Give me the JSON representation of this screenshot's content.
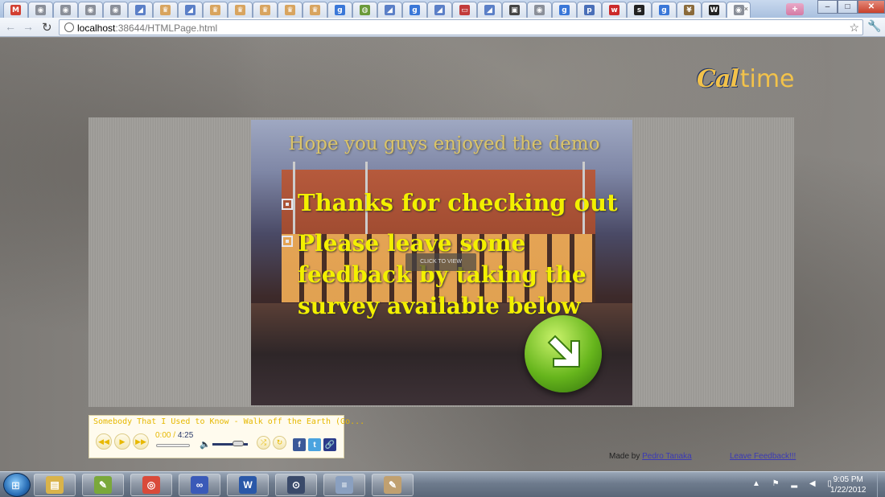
{
  "browser": {
    "tabs": [
      {
        "icon": "gmail-icon",
        "glyph": "M",
        "color": "#d23f31"
      },
      {
        "icon": "page-icon",
        "glyph": "◉",
        "color": "#8a8f99"
      },
      {
        "icon": "page-icon",
        "glyph": "◉",
        "color": "#8a8f99"
      },
      {
        "icon": "page-icon",
        "glyph": "◉",
        "color": "#8a8f99"
      },
      {
        "icon": "page-icon",
        "glyph": "◉",
        "color": "#8a8f99"
      },
      {
        "icon": "docs-icon",
        "glyph": "◢",
        "color": "#5b7fc7"
      },
      {
        "icon": "crown-icon",
        "glyph": "♛",
        "color": "#d8a45f"
      },
      {
        "icon": "docs-icon",
        "glyph": "◢",
        "color": "#5b7fc7"
      },
      {
        "icon": "crown-icon",
        "glyph": "♛",
        "color": "#d8a45f"
      },
      {
        "icon": "crown-icon",
        "glyph": "♛",
        "color": "#d8a45f"
      },
      {
        "icon": "crown-icon",
        "glyph": "♛",
        "color": "#d8a45f"
      },
      {
        "icon": "crown-icon",
        "glyph": "♛",
        "color": "#d8a45f"
      },
      {
        "icon": "crown-icon",
        "glyph": "♛",
        "color": "#d8a45f"
      },
      {
        "icon": "google-icon",
        "glyph": "g",
        "color": "#3a77d8"
      },
      {
        "icon": "globe-icon",
        "glyph": "◍",
        "color": "#6a9a3a"
      },
      {
        "icon": "docs-icon",
        "glyph": "◢",
        "color": "#5b7fc7"
      },
      {
        "icon": "google-icon",
        "glyph": "g",
        "color": "#3a77d8"
      },
      {
        "icon": "docs-icon",
        "glyph": "◢",
        "color": "#5b7fc7"
      },
      {
        "icon": "card-icon",
        "glyph": "▭",
        "color": "#c23b3b"
      },
      {
        "icon": "docs-icon",
        "glyph": "◢",
        "color": "#5b7fc7"
      },
      {
        "icon": "scholar-icon",
        "glyph": "▣",
        "color": "#444"
      },
      {
        "icon": "page-icon",
        "glyph": "◉",
        "color": "#8a8f99"
      },
      {
        "icon": "google-icon",
        "glyph": "g",
        "color": "#3a77d8"
      },
      {
        "icon": "p-icon",
        "glyph": "p",
        "color": "#4a6fb8"
      },
      {
        "icon": "w-red-icon",
        "glyph": "w",
        "color": "#cc2a2a"
      },
      {
        "icon": "sf-icon",
        "glyph": "s",
        "color": "#222"
      },
      {
        "icon": "google-icon",
        "glyph": "g",
        "color": "#3a77d8"
      },
      {
        "icon": "book-icon",
        "glyph": "¥",
        "color": "#8a6a3a"
      },
      {
        "icon": "wikipedia-icon",
        "glyph": "W",
        "color": "#222"
      },
      {
        "icon": "page-icon",
        "glyph": "◉",
        "color": "#8a8f99",
        "close": "×"
      }
    ],
    "new_tab": "+",
    "window_controls": {
      "minimize": "–",
      "maximize": "□",
      "close": "✕"
    },
    "back": "←",
    "forward": "→",
    "reload": "↻",
    "url_host": "localhost",
    "url_rest": ":38644/HTMLPage.html",
    "bookmark_star": "☆",
    "wrench": "🔧"
  },
  "page": {
    "logo_cal": "Cal",
    "logo_time": "time",
    "slide": {
      "title": "Hope you guys enjoyed the demo",
      "bullets": [
        "Thanks for checking out",
        "Please leave some feedback by taking the survey available below"
      ],
      "overlay": "CLICK TO VIEW"
    },
    "player": {
      "track": "Somebody That I Used to Know - Walk off the Earth (Go...",
      "time_current": "0:00",
      "time_sep": " / ",
      "time_total": "4:25",
      "progress": 0,
      "volume": 0.8,
      "rewind": "◀◀",
      "play": "▶",
      "forward": "▶▶",
      "shuffle": "⤮",
      "repeat": "↻",
      "share_facebook": "f",
      "share_twitter": "t",
      "share_link": "🔗"
    },
    "made_by_prefix": "Made by ",
    "made_by_name": "Pedro Tanaka",
    "leave_feedback": "Leave Feedback!!!"
  },
  "taskbar": {
    "start": "⊞",
    "apps": [
      {
        "icon": "explorer-icon",
        "glyph": "▤",
        "color": "#d9b34a"
      },
      {
        "icon": "notepad-icon",
        "glyph": "✎",
        "color": "#7aa83a"
      },
      {
        "icon": "chrome-icon",
        "glyph": "◎",
        "color": "#d94a3a"
      },
      {
        "icon": "infinity-app-icon",
        "glyph": "∞",
        "color": "#3a5ab8"
      },
      {
        "icon": "word-icon",
        "glyph": "W",
        "color": "#2a58a8"
      },
      {
        "icon": "lock-app-icon",
        "glyph": "⊙",
        "color": "#3a4a6a"
      },
      {
        "icon": "stack-app-icon",
        "glyph": "≡",
        "color": "#8aa0c0"
      },
      {
        "icon": "paint-icon",
        "glyph": "✎",
        "color": "#c0a070"
      }
    ],
    "tray_icons": "▲ ⚑ ▂ ◀ ▯",
    "time": "9:05 PM",
    "date": "1/22/2012"
  }
}
